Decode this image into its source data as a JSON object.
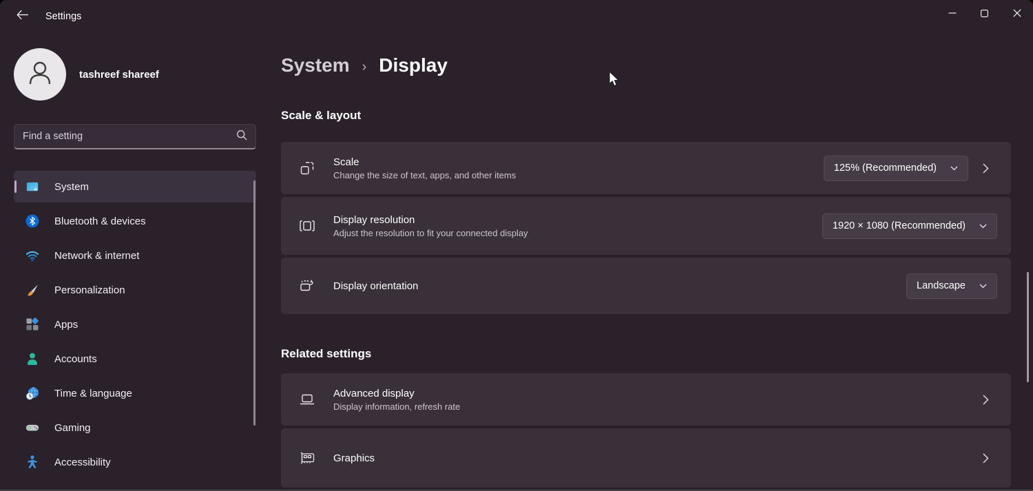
{
  "titlebar": {
    "title": "Settings"
  },
  "window_controls": {
    "minimize": "minimize-icon",
    "maximize": "maximize-icon",
    "close": "close-icon"
  },
  "sidebar": {
    "user": {
      "name": "tashreef shareef",
      "avatar_icon": "person-outline-icon"
    },
    "search": {
      "placeholder": "Find a setting",
      "icon": "search-icon"
    },
    "items": [
      {
        "label": "System",
        "icon": "monitor-icon",
        "selected": true
      },
      {
        "label": "Bluetooth & devices",
        "icon": "bluetooth-icon",
        "selected": false
      },
      {
        "label": "Network & internet",
        "icon": "wifi-icon",
        "selected": false
      },
      {
        "label": "Personalization",
        "icon": "paintbrush-icon",
        "selected": false
      },
      {
        "label": "Apps",
        "icon": "apps-grid-icon",
        "selected": false
      },
      {
        "label": "Accounts",
        "icon": "person-icon",
        "selected": false
      },
      {
        "label": "Time & language",
        "icon": "globe-clock-icon",
        "selected": false
      },
      {
        "label": "Gaming",
        "icon": "gamepad-icon",
        "selected": false
      },
      {
        "label": "Accessibility",
        "icon": "accessibility-icon",
        "selected": false
      }
    ]
  },
  "main": {
    "breadcrumb": {
      "root": "System",
      "sep": "›",
      "page": "Display"
    },
    "scale_layout": {
      "heading": "Scale & layout",
      "scale": {
        "title": "Scale",
        "subtitle": "Change the size of text, apps, and other items",
        "value": "125% (Recommended)",
        "icon": "scale-icon"
      },
      "resolution": {
        "title": "Display resolution",
        "subtitle": "Adjust the resolution to fit your connected display",
        "value": "1920 × 1080 (Recommended)",
        "icon": "resolution-icon"
      },
      "orientation": {
        "title": "Display orientation",
        "value": "Landscape",
        "icon": "orientation-icon"
      }
    },
    "related": {
      "heading": "Related settings",
      "advanced_display": {
        "title": "Advanced display",
        "subtitle": "Display information, refresh rate",
        "icon": "laptop-icon"
      },
      "graphics": {
        "title": "Graphics",
        "icon": "gpu-icon"
      }
    }
  },
  "colors": {
    "window_bg": "#2a212b",
    "card_bg": "#393039",
    "dropdown_bg": "#463c48",
    "accent_pill": "#c9a2cf",
    "subtitle_text": "#cbc5ce"
  }
}
